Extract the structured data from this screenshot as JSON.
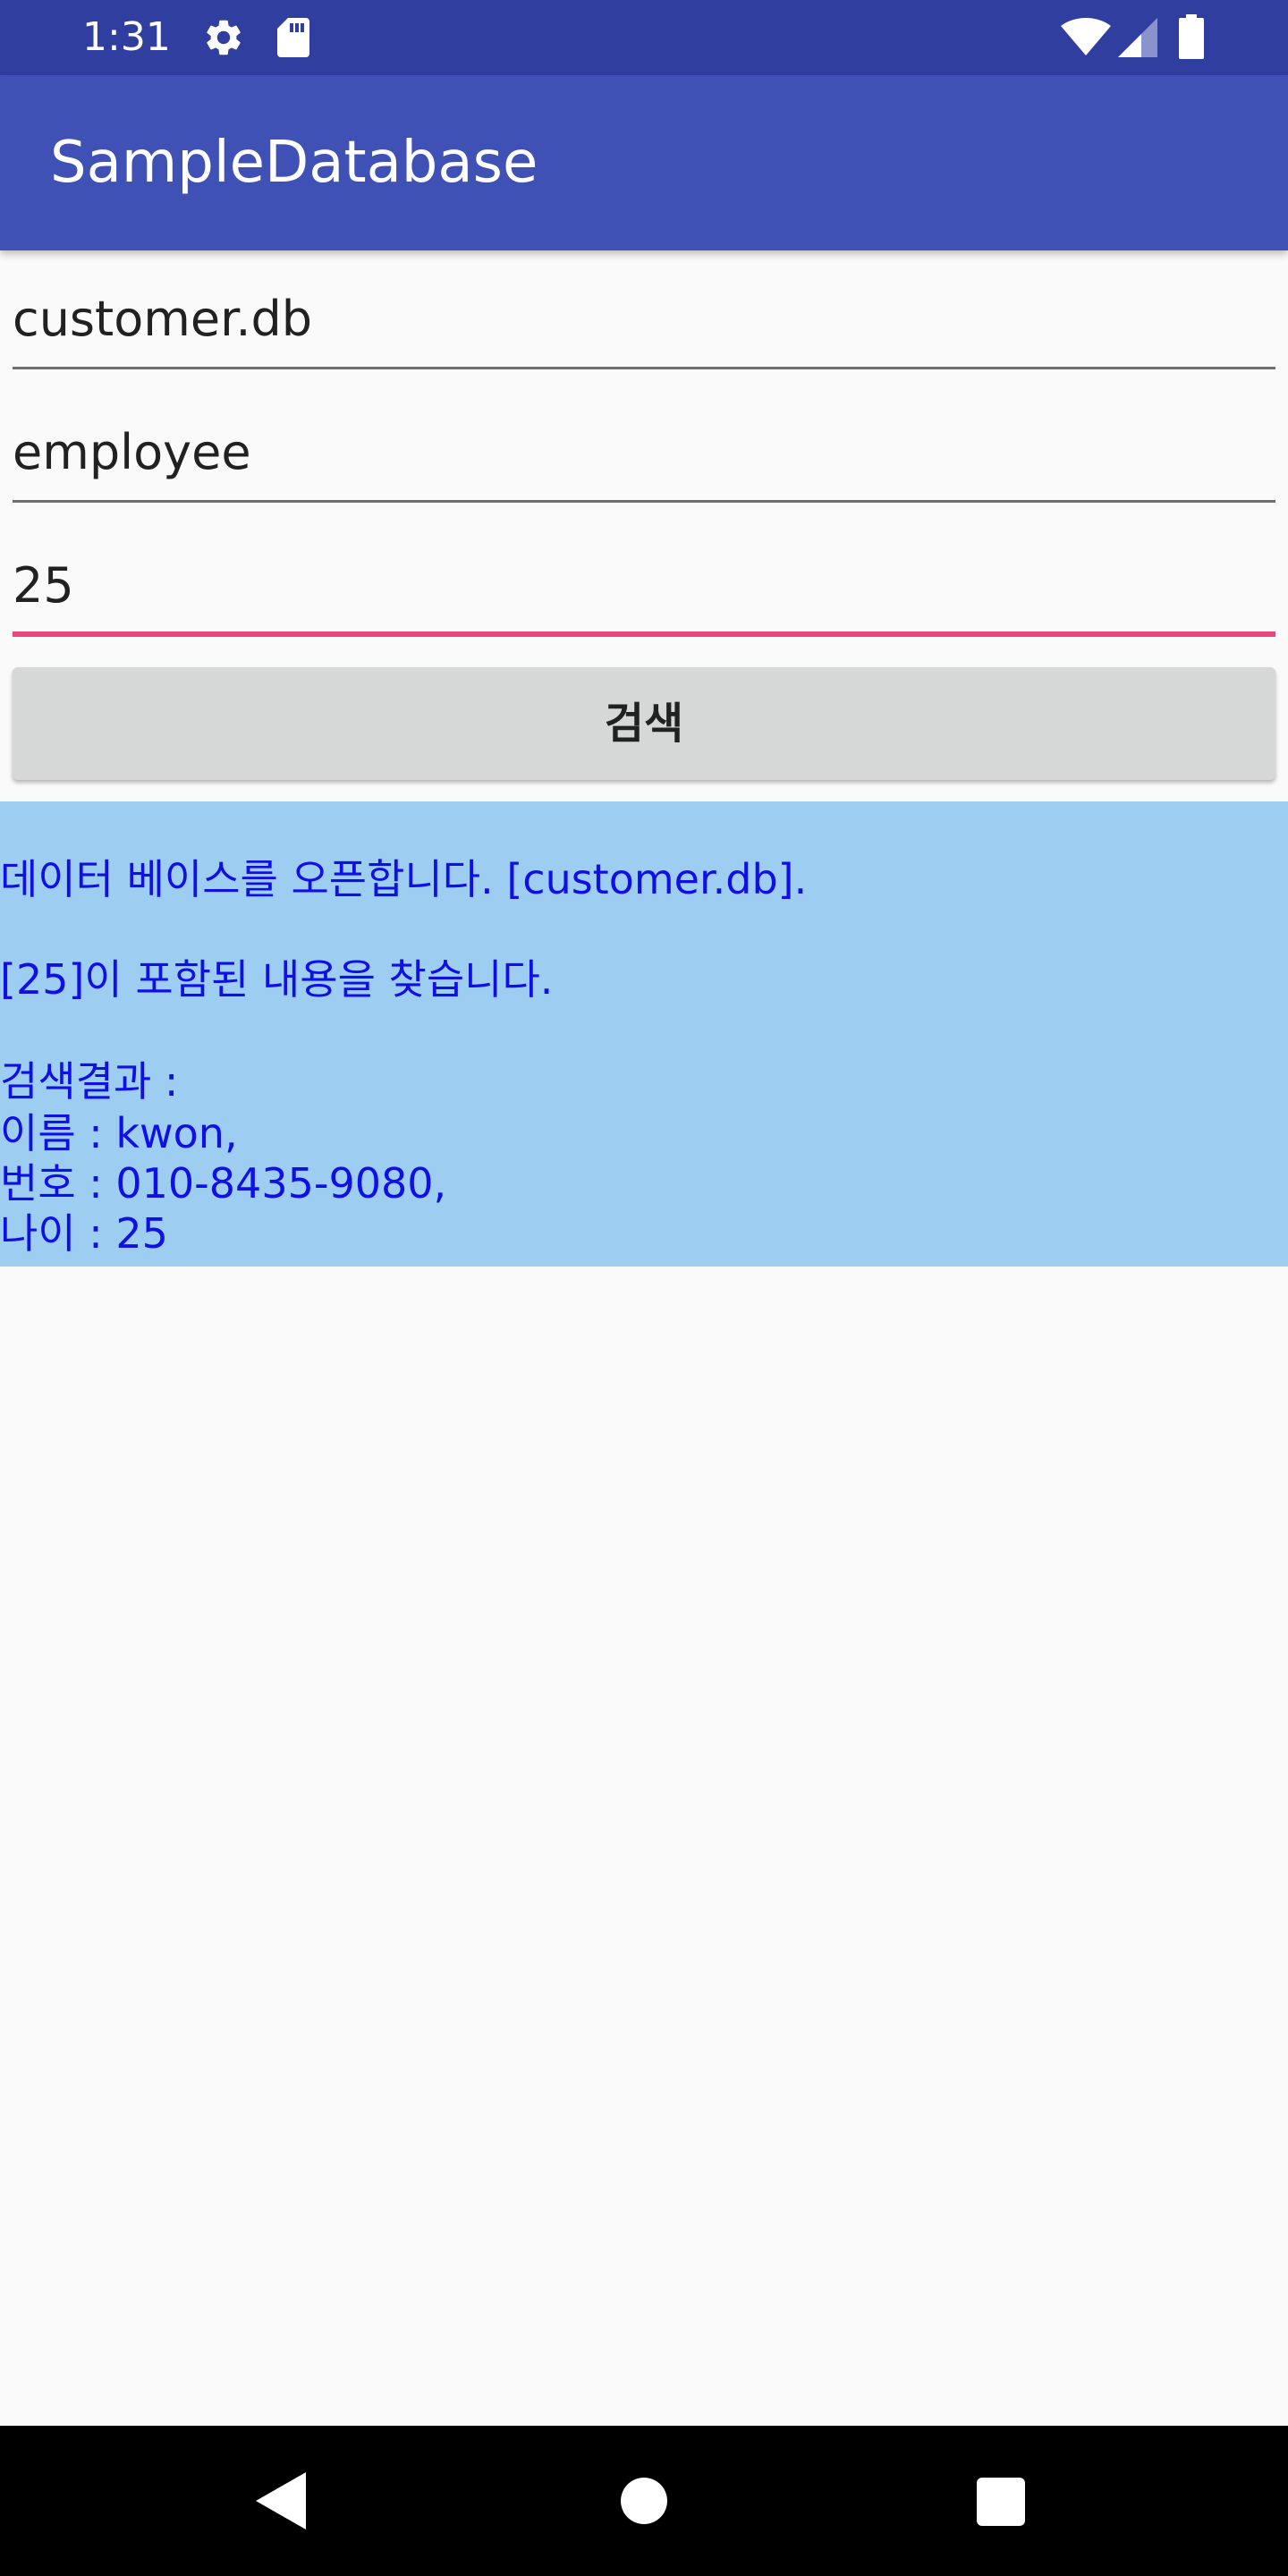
{
  "status_bar": {
    "time": "1:31",
    "icons": [
      "gear-icon",
      "sd-card-icon",
      "wifi-icon",
      "cell-signal-icon",
      "battery-icon"
    ]
  },
  "app_bar": {
    "title": "SampleDatabase"
  },
  "form": {
    "database_field": {
      "value": "customer.db"
    },
    "table_field": {
      "value": "employee"
    },
    "search_field": {
      "value": "25"
    },
    "search_button_label": "검색"
  },
  "result": {
    "lines": [
      "데이터 베이스를 오픈합니다. [customer.db].",
      "[25]이 포함된 내용을 찾습니다.",
      "검색결과 :",
      "이름 : kwon,",
      "번호 : 010-8435-9080,",
      "나이 : 25"
    ]
  },
  "nav_bar": {
    "icons": [
      "back-icon",
      "home-icon",
      "recents-icon"
    ]
  },
  "colors": {
    "status_bar": "#303f9f",
    "app_bar": "#3f51b5",
    "accent": "#e8467c",
    "result_background": "#9dcdf0",
    "result_text": "#1010e6"
  }
}
